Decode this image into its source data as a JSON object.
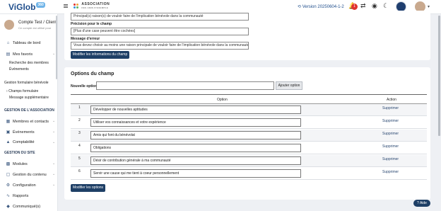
{
  "header": {
    "logo_text": "ViGlob",
    "logo_badge": "360",
    "assoc_title": "ASSOCIATION",
    "assoc_subtitle": "DES AMIS D'EXEMPLE",
    "version": "Version 20250604-1-2",
    "notification_count": "1",
    "icons": [
      "menu-icon",
      "history-icon",
      "notification-icon",
      "transfer-icon",
      "eye-icon",
      "moon-icon"
    ]
  },
  "sidebar": {
    "user_name": "Compte Test / Client",
    "user_note": "Ce compte est utilisé pour",
    "dashboard": "Tableau de bord",
    "favorites": "Mes favoris",
    "fav_items": [
      "Recherche des membres",
      "Événements"
    ],
    "volunteer_form": "Gestion formulaire bénévole",
    "form_items": [
      "Champs formulaire",
      "Message supplémentaire"
    ],
    "section_assoc": "GESTION DE L'ASSOCIATION",
    "assoc_items": [
      "Membres et contacts",
      "Événements",
      "Comptabilité"
    ],
    "section_site": "GESTION DU SITE",
    "site_items": [
      "Modules",
      "Gestion du contenu",
      "Configuration",
      "Rapports",
      "Communiqué(s)"
    ]
  },
  "field_form": {
    "top_value": "Principal(s) raison(s) de vouloir faire de l'implication bénévole dans la communauté",
    "precision_label": "Précision pour le champ",
    "precision_value": "[Plus d'une case peuvent être cochées]",
    "error_label": "Message d'erreur",
    "error_value": "Vous devez choisir au moins une raison principale de vouloir faire de l'implication bénévole dans la communauté",
    "modify_button": "Modifier les informations du champ"
  },
  "options": {
    "title": "Options du champ",
    "new_option_label": "Nouvelle option",
    "new_option_value": "",
    "add_button": "Ajouter option",
    "col_option": "Option",
    "col_action": "Action",
    "delete_label": "Supprimer",
    "rows": [
      {
        "num": "1",
        "text": "Développer de nouvelles aptitudes"
      },
      {
        "num": "2",
        "text": "Utiliser vos connaissances et votre expérience"
      },
      {
        "num": "3",
        "text": "Amis qui font du bénévolat"
      },
      {
        "num": "4",
        "text": "Obligations"
      },
      {
        "num": "5",
        "text": "Désir de contribution générale à ma communauté"
      },
      {
        "num": "6",
        "text": "Servir une cause qui me tient à coeur personnellement"
      }
    ],
    "modify_options_button": "Modifier les options"
  },
  "help_button": "Aide",
  "colors": {
    "primary": "#1e3f66",
    "accent": "#e0322e"
  }
}
